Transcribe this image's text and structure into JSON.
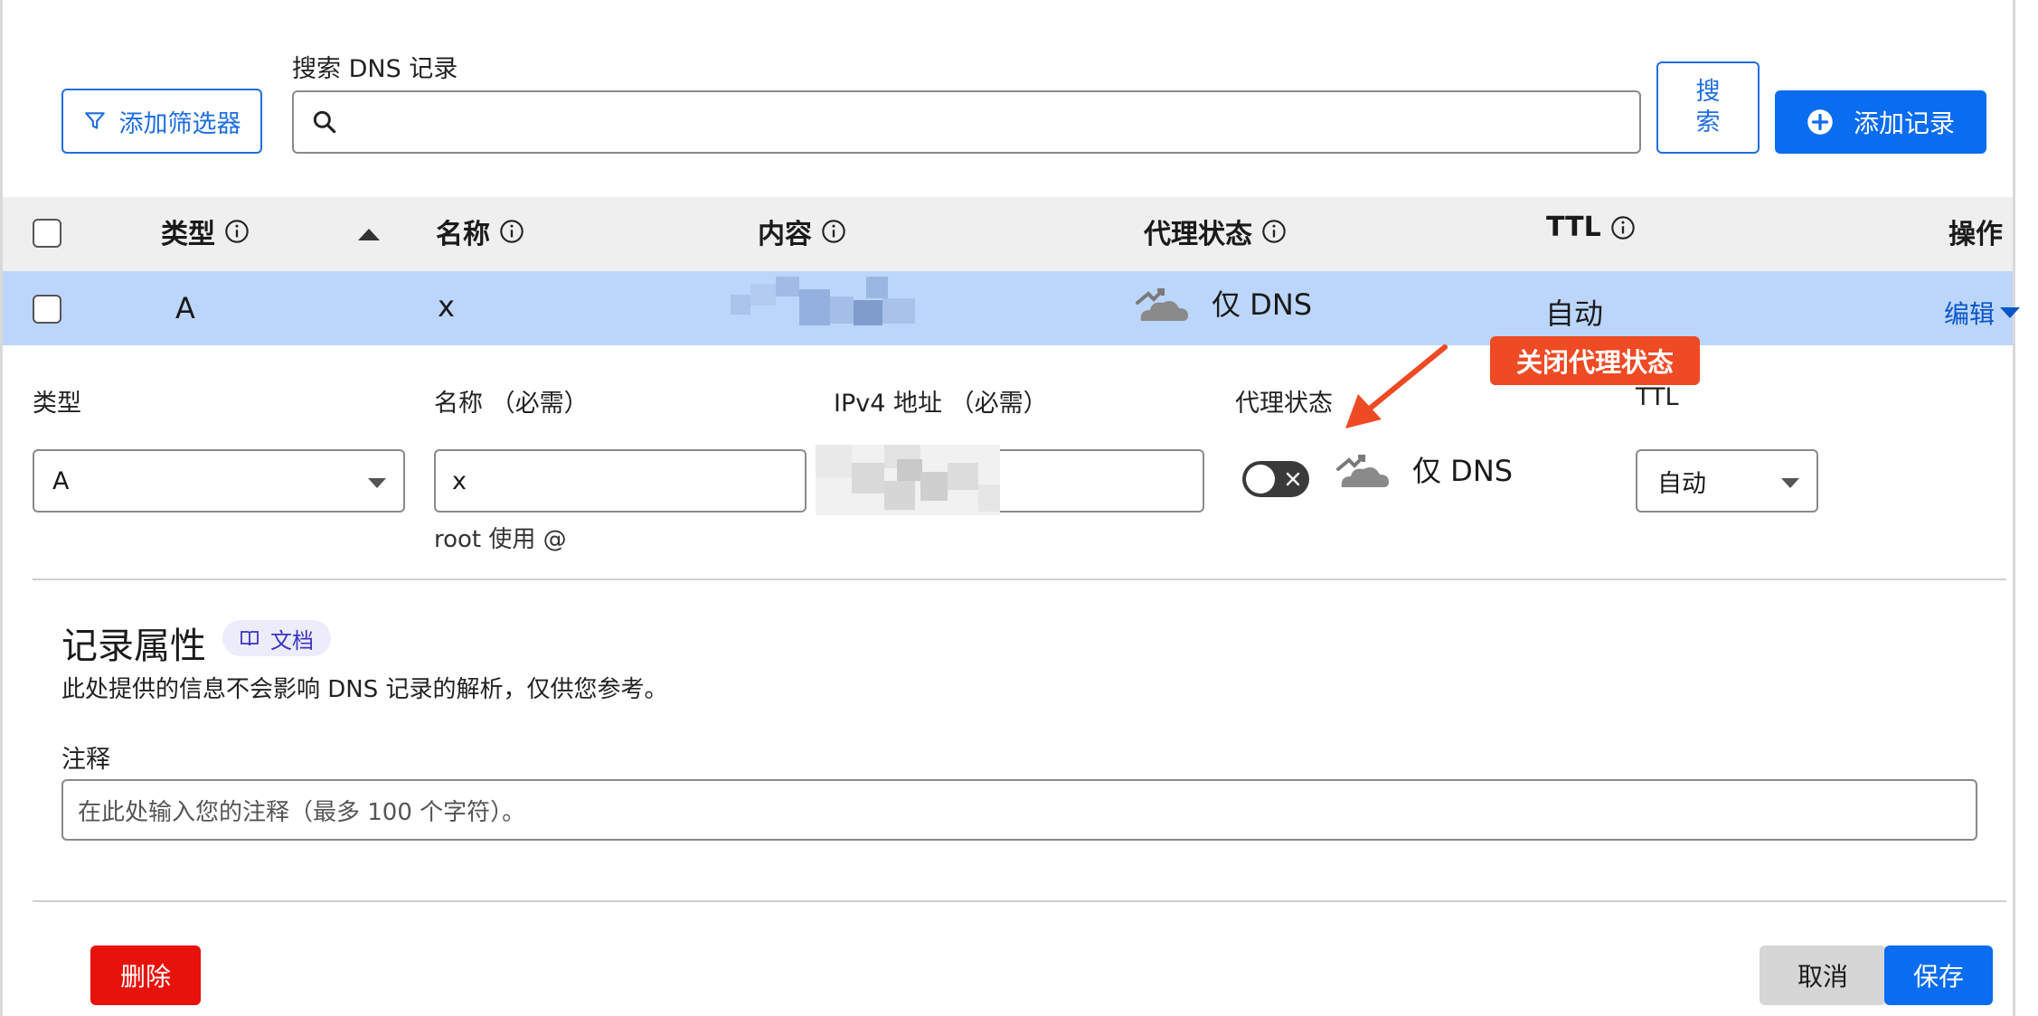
{
  "toolbar": {
    "filter_label": "添加筛选器",
    "search_label": "搜索 DNS 记录",
    "search_value": "",
    "search_button": "搜\n索",
    "add_record": "添加记录"
  },
  "table": {
    "headers": {
      "type": "类型",
      "name": "名称",
      "content": "内容",
      "proxy": "代理状态",
      "ttl": "TTL",
      "actions": "操作"
    },
    "row": {
      "type": "A",
      "name": "x",
      "proxy": "仅 DNS",
      "ttl": "自动",
      "edit": "编辑"
    }
  },
  "annotation": {
    "callout": "关闭代理状态"
  },
  "form": {
    "type_label": "类型",
    "type_value": "A",
    "name_label": "名称 （必需）",
    "name_value": "x",
    "name_hint": "root 使用 @",
    "ipv4_label": "IPv4 地址 （必需）",
    "proxy_label": "代理状态",
    "proxy_value": "仅 DNS",
    "proxy_enabled": false,
    "ttl_label": "TTL",
    "ttl_value": "自动"
  },
  "attributes": {
    "title": "记录属性",
    "docs_badge": "文档",
    "description": "此处提供的信息不会影响 DNS 记录的解析，仅供您参考。",
    "comment_label": "注释",
    "comment_placeholder": "在此处输入您的注释（最多 100 个字符）。"
  },
  "footer": {
    "delete": "删除",
    "cancel": "取消",
    "save": "保存"
  },
  "colors": {
    "accent": "#0a6cf0",
    "row_selected": "#bcd6fb",
    "danger": "#e8120c",
    "callout": "#ee4a23"
  }
}
